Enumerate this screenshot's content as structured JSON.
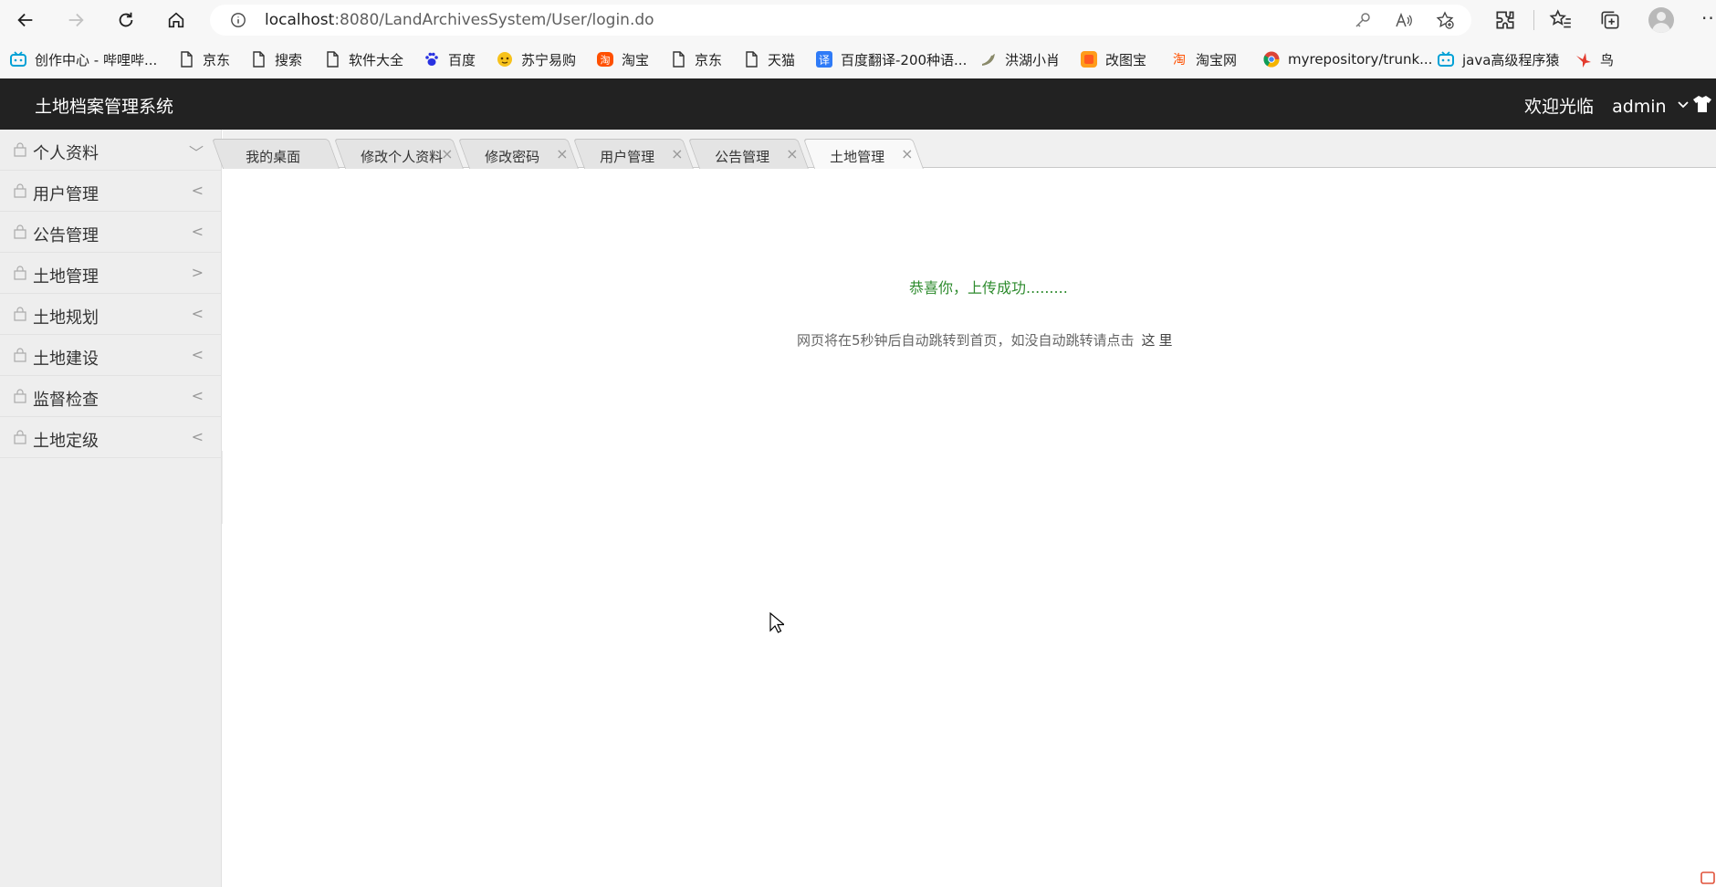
{
  "browser": {
    "url_host": "localhost",
    "url_path": ":8080/LandArchivesSystem/User/login.do"
  },
  "bookmarks": [
    {
      "label": "创作中心 - 哔哩哔...",
      "icon": "bilibili-icon",
      "color": "#00a1d6"
    },
    {
      "label": "京东",
      "icon": "page-icon"
    },
    {
      "label": "搜索",
      "icon": "page-icon"
    },
    {
      "label": "软件大全",
      "icon": "page-icon"
    },
    {
      "label": "百度",
      "icon": "baidu-paw-icon",
      "color": "#2932e1"
    },
    {
      "label": "苏宁易购",
      "icon": "suning-icon",
      "color": "#f7c21b"
    },
    {
      "label": "淘宝",
      "icon": "taobao-icon",
      "color": "#ff5000"
    },
    {
      "label": "京东",
      "icon": "page-icon"
    },
    {
      "label": "天猫",
      "icon": "page-icon"
    },
    {
      "label": "百度翻译-200种语...",
      "icon": "translate-icon",
      "color": "#2f7bf7"
    },
    {
      "label": "洪湖小肖",
      "icon": "bird-icon"
    },
    {
      "label": "改图宝",
      "icon": "gaitubao-icon",
      "color": "#ff9c1a"
    },
    {
      "label": "淘宝网",
      "icon": "taobao-icon",
      "color": "#ff5000"
    },
    {
      "label": "myrepository/trunk...",
      "icon": "chrome-icon"
    },
    {
      "label": "java高级程序猿",
      "icon": "bilibili-icon",
      "color": "#00a1d6"
    },
    {
      "label": "鸟",
      "icon": "swallow-icon",
      "color": "#e33b2e"
    }
  ],
  "app": {
    "title": "土地档案管理系统",
    "welcome": "欢迎光临",
    "user": "admin"
  },
  "sidebar": {
    "items": [
      {
        "label": "个人资料",
        "arrow": "﹀"
      },
      {
        "label": "用户管理",
        "arrow": "<"
      },
      {
        "label": "公告管理",
        "arrow": "<"
      },
      {
        "label": "土地管理",
        "arrow": ">"
      },
      {
        "label": "土地规划",
        "arrow": "<"
      },
      {
        "label": "土地建设",
        "arrow": "<"
      },
      {
        "label": "监督检查",
        "arrow": "<"
      },
      {
        "label": "土地定级",
        "arrow": "<"
      }
    ]
  },
  "tabs": [
    {
      "label": "我的桌面",
      "closable": false
    },
    {
      "label": "修改个人资料",
      "closable": true
    },
    {
      "label": "修改密码",
      "closable": true
    },
    {
      "label": "用户管理",
      "closable": true
    },
    {
      "label": "公告管理",
      "closable": true
    },
    {
      "label": "土地管理",
      "closable": true,
      "active": true
    }
  ],
  "tab_close_glyph": "×",
  "content": {
    "success": "恭喜你，上传成功.........",
    "redirect_text": "网页将在5秒钟后自动跳转到首页，如没自动跳转请点击",
    "redirect_link": "这里"
  },
  "colors": {
    "header_bg": "#222222",
    "sidebar_bg": "#eeeeee",
    "success_text": "#2e8b2e"
  }
}
